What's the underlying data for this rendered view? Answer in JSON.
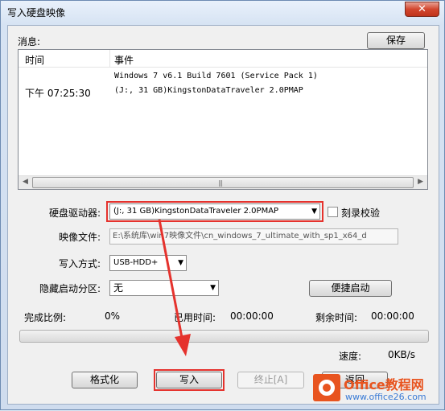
{
  "window": {
    "title": "写入硬盘映像",
    "close_glyph": "✕"
  },
  "log": {
    "label": "消息:",
    "save_button": "保存",
    "columns": [
      "时间",
      "事件"
    ],
    "entry": {
      "time": "下午 07:25:30",
      "event_line1": "Windows 7 v6.1 Build 7601 (Service Pack 1)",
      "event_line2": "(J:, 31 GB)KingstonDataTraveler 2.0PMAP"
    }
  },
  "form": {
    "drive_label": "硬盘驱动器:",
    "drive_value": "(J:, 31 GB)KingstonDataTraveler 2.0PMAP",
    "verify_label": "刻录校验",
    "image_label": "映像文件:",
    "image_value": "E:\\系统库\\win7映像文件\\cn_windows_7_ultimate_with_sp1_x64_d",
    "write_method_label": "写入方式:",
    "write_method_value": "USB-HDD+",
    "hidden_partition_label": "隐藏启动分区:",
    "hidden_partition_value": "无",
    "quick_boot_button": "便捷启动"
  },
  "progress": {
    "completed_label": "完成比例:",
    "completed_value": "0%",
    "elapsed_label": "已用时间:",
    "elapsed_value": "00:00:00",
    "remaining_label": "剩余时间:",
    "remaining_value": "00:00:00",
    "speed_label": "速度:",
    "speed_value": "0KB/s",
    "fraction": 0
  },
  "buttons": {
    "format": "格式化",
    "write": "写入",
    "stop": "终止[A]",
    "back": "返回"
  },
  "watermark": {
    "brand": "Office教程网",
    "url": "www.office26.com"
  },
  "colors": {
    "highlight": "#e5322d"
  }
}
